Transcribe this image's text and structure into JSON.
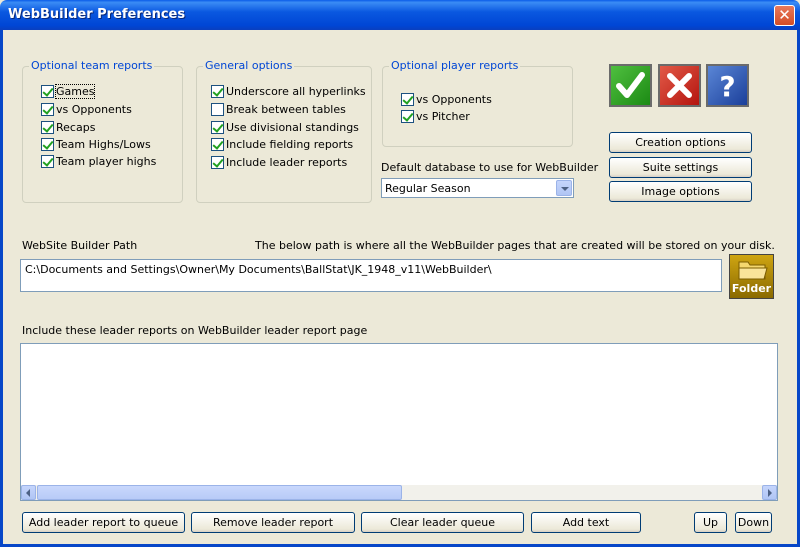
{
  "window": {
    "title": "WebBuilder Preferences",
    "close_symbol": "✕"
  },
  "team_reports": {
    "label": "Optional team reports",
    "items": [
      {
        "label": "Games",
        "checked": true
      },
      {
        "label": "vs Opponents",
        "checked": true
      },
      {
        "label": "Recaps",
        "checked": true
      },
      {
        "label": "Team Highs/Lows",
        "checked": true
      },
      {
        "label": "Team player highs",
        "checked": true
      }
    ]
  },
  "general_options": {
    "label": "General options",
    "items": [
      {
        "label": "Underscore all hyperlinks",
        "checked": true
      },
      {
        "label": "Break between tables",
        "checked": false
      },
      {
        "label": "Use divisional standings",
        "checked": true
      },
      {
        "label": "Include fielding reports",
        "checked": true
      },
      {
        "label": "Include leader reports",
        "checked": true
      }
    ]
  },
  "player_reports": {
    "label": "Optional player reports",
    "items": [
      {
        "label": "vs Opponents",
        "checked": true
      },
      {
        "label": "vs Pitcher",
        "checked": true
      }
    ]
  },
  "database": {
    "label": "Default database to use for WebBuilder",
    "selected": "Regular Season"
  },
  "side_buttons": {
    "creation": "Creation options",
    "suite": "Suite settings",
    "image": "Image options"
  },
  "path": {
    "label": "WebSite Builder Path",
    "description": "The below path is where all the WebBuilder pages that are created will be stored on your disk.",
    "value": "C:\\Documents and Settings\\Owner\\My Documents\\BallStat\\JK_1948_v11\\WebBuilder\\",
    "folder_label": "Folder"
  },
  "leader": {
    "label": "Include these leader reports on WebBuilder leader report page"
  },
  "bottom_buttons": {
    "add": "Add leader report to queue",
    "remove": "Remove leader report",
    "clear": "Clear leader queue",
    "add_text": "Add text",
    "up": "Up",
    "down": "Down"
  },
  "colors": {
    "title_bar": "#0046d5",
    "group_label": "#0046d5",
    "ok_button": "#1c8a14",
    "cancel_button": "#b4140f",
    "help_button": "#1b3f9a",
    "folder_button": "#b8900b"
  },
  "icons": {
    "ok": "checkmark-icon",
    "cancel": "x-icon",
    "help": "question-icon",
    "folder": "folder-icon"
  }
}
